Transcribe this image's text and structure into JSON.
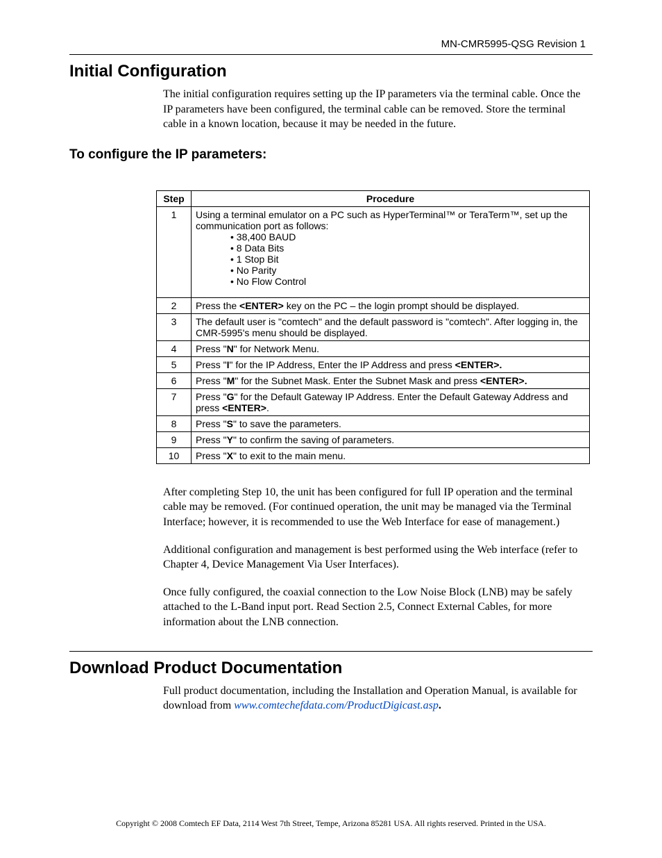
{
  "header": {
    "doc_id": "MN-CMR5995-QSG    Revision 1"
  },
  "section1": {
    "title": "Initial Configuration",
    "intro": "The initial configuration requires setting up the IP parameters via the terminal cable. Once the IP parameters have been configured, the terminal cable can be removed. Store the terminal cable in a known location, because it may be needed in the future.",
    "subheading": "To configure the IP parameters:"
  },
  "table": {
    "col_step": "Step",
    "col_proc": "Procedure",
    "rows": [
      {
        "step": "1",
        "proc_intro": "Using a terminal emulator on a PC such as HyperTerminal™ or TeraTerm™, set up the communication port as follows:",
        "bullets": [
          "• 38,400 BAUD",
          "• 8 Data Bits",
          "• 1 Stop Bit",
          "• No Parity",
          "• No Flow Control"
        ]
      },
      {
        "step": "2",
        "text_pre": "Press the ",
        "bold1": "<ENTER>",
        "text_post": " key on the PC – the login prompt should be displayed."
      },
      {
        "step": "3",
        "plain": "The default user is \"comtech\" and the default password is \"comtech\". After logging in, the CMR-5995's menu should be displayed."
      },
      {
        "step": "4",
        "text_pre": "Press \"",
        "bold1": "N",
        "text_post": "\" for Network Menu."
      },
      {
        "step": "5",
        "text_pre": "Press \"",
        "bold1": "I",
        "text_mid": "\" for the IP Address, Enter the IP Address and press ",
        "bold2": "<ENTER>.",
        "text_post": ""
      },
      {
        "step": "6",
        "text_pre": "Press \"",
        "bold1": "M",
        "text_mid": "\" for the Subnet Mask. Enter the Subnet Mask and press ",
        "bold2": "<ENTER>.",
        "text_post": ""
      },
      {
        "step": "7",
        "text_pre": "Press \"",
        "bold1": "G",
        "text_mid": "\" for the Default Gateway IP Address. Enter the Default Gateway Address and press ",
        "bold2": "<ENTER>",
        "text_post": "."
      },
      {
        "step": "8",
        "text_pre": "Press \"",
        "bold1": "S",
        "text_post": "\" to save the parameters."
      },
      {
        "step": "9",
        "text_pre": "Press \"",
        "bold1": "Y",
        "text_post": "\" to confirm the saving of parameters."
      },
      {
        "step": "10",
        "text_pre": "Press \"",
        "bold1": "X",
        "text_post": "\" to exit to the main menu."
      }
    ]
  },
  "after_table": {
    "p1": "After completing Step 10, the unit has been configured for full IP operation and the terminal cable may be removed.  (For continued operation, the unit may be managed via the Terminal Interface; however, it is recommended to use the Web Interface for ease of management.)",
    "p2": "Additional configuration and management is best performed using the Web interface (refer to Chapter 4, Device Management Via User Interfaces).",
    "p3": "Once fully configured, the coaxial connection to the Low Noise Block (LNB) may be safely attached to the L-Band input port. Read Section 2.5, Connect External Cables, for more information about the LNB connection."
  },
  "section2": {
    "title": "Download Product Documentation",
    "text_pre": "Full product documentation, including the Installation and Operation Manual, is available for download from ",
    "link": "www.comtechefdata.com/ProductDigicast.asp",
    "text_post": "."
  },
  "footer": "Copyright © 2008 Comtech EF Data, 2114 West 7th Street, Tempe, Arizona 85281 USA. All rights reserved. Printed in the USA."
}
